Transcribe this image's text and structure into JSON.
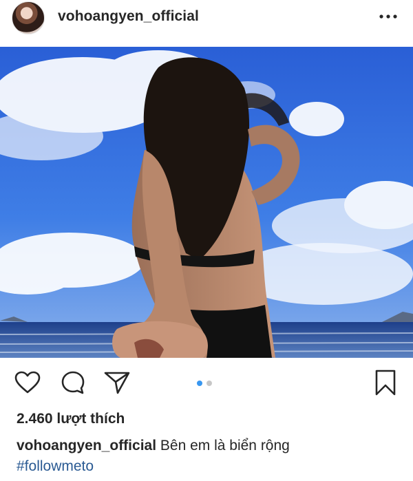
{
  "post": {
    "username": "vohoangyen_official",
    "likes": "2.460 lượt thích",
    "caption_text": "Bên em là biển rộng",
    "hashtag": "#followmeto",
    "carousel": {
      "count": 2,
      "active_index": 0
    }
  },
  "icons": {
    "more": "more-options-icon",
    "like": "heart-icon",
    "comment": "comment-icon",
    "share": "share-icon",
    "save": "bookmark-icon"
  },
  "colors": {
    "text": "#262626",
    "hashtag": "#2a5a93",
    "carousel_active": "#3897f0",
    "carousel_inactive": "#c7c7c7"
  }
}
